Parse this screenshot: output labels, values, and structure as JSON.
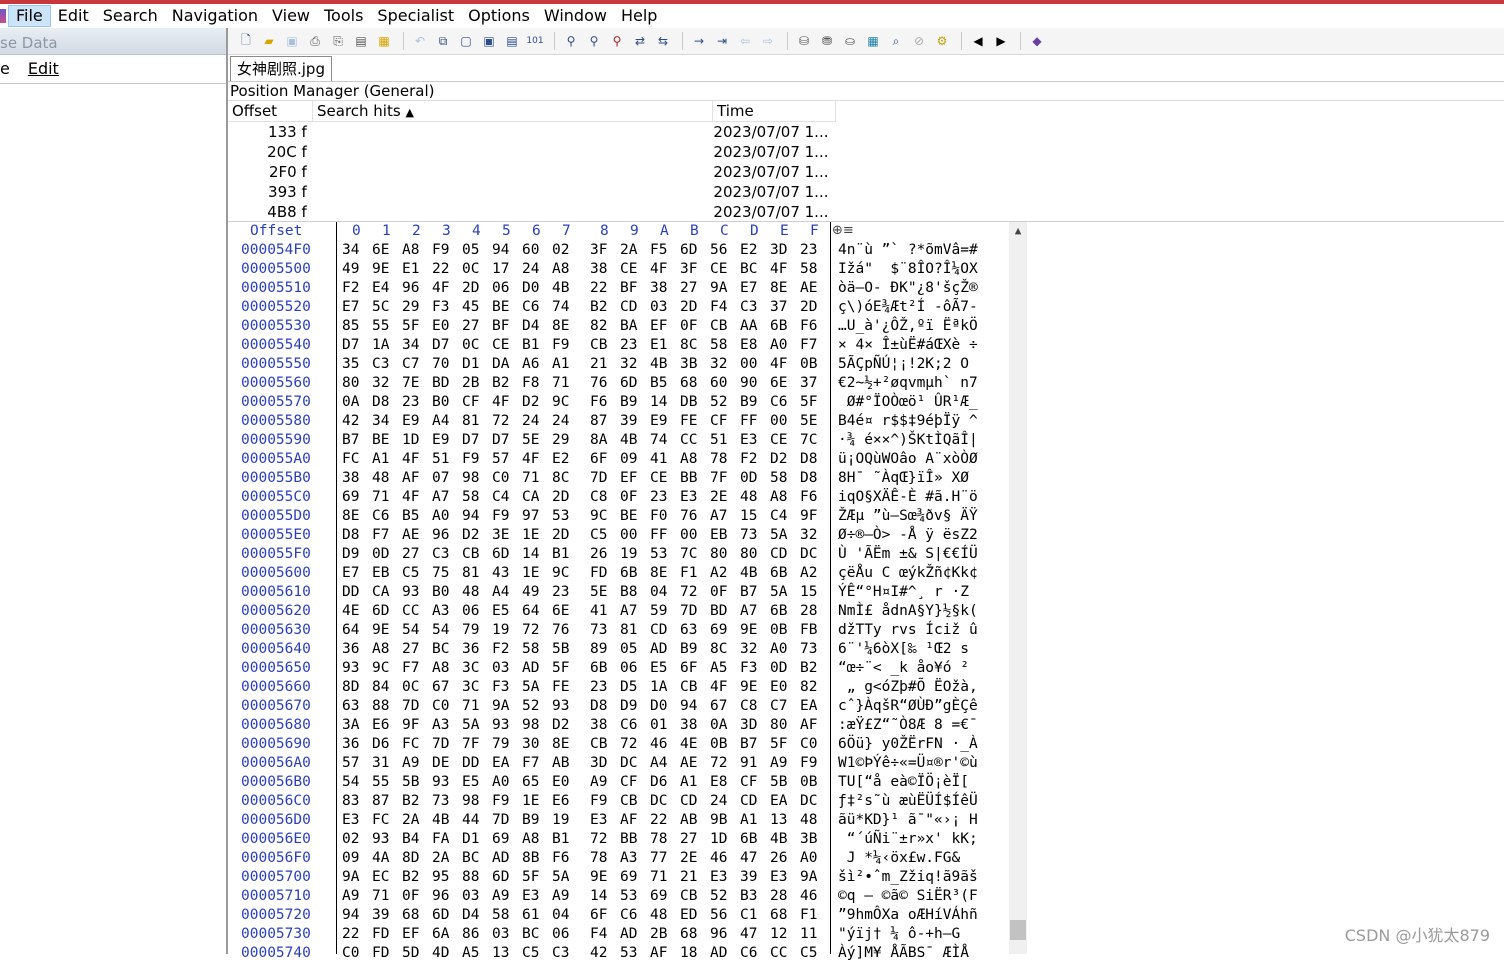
{
  "menubar": {
    "items": [
      "File",
      "Edit",
      "Search",
      "Navigation",
      "View",
      "Tools",
      "Specialist",
      "Options",
      "Window",
      "Help"
    ]
  },
  "left_panel": {
    "title": "se Data",
    "menu": [
      "e",
      "Edit"
    ]
  },
  "toolbar": {
    "icons": [
      "new-file-icon",
      "open-file-icon",
      "save-icon",
      "print-icon",
      "print-preview-icon",
      "properties-icon",
      "folder-icon",
      "undo-icon",
      "copy-icon",
      "paste-icon",
      "paste-special-icon",
      "clipboard-icon",
      "binary-icon",
      "find-icon",
      "find-next-icon",
      "find-hex-icon",
      "replace-icon",
      "replace-hex-icon",
      "goto-icon",
      "goto-offset-icon",
      "back-icon",
      "forward-icon",
      "disk-icon",
      "disk-stack-icon",
      "drive-icon",
      "calculator-icon",
      "magnify-icon",
      "no-icon",
      "gear-icon",
      "prev-icon",
      "next-icon",
      "book-icon"
    ]
  },
  "tab": {
    "label": "女神剧照.jpg"
  },
  "position_manager": {
    "title": "Position Manager (General)",
    "columns": {
      "offset": "Offset",
      "hits": "Search hits",
      "time": "Time"
    },
    "sort_arrow": "▲",
    "rows": [
      {
        "offset": "133 f",
        "hits": "",
        "time": "2023/07/07  1..."
      },
      {
        "offset": "20C f",
        "hits": "",
        "time": "2023/07/07  1..."
      },
      {
        "offset": "2F0 f",
        "hits": "",
        "time": "2023/07/07  1..."
      },
      {
        "offset": "393 f",
        "hits": "",
        "time": "2023/07/07  1..."
      },
      {
        "offset": "4B8 f",
        "hits": "",
        "time": "2023/07/07  1..."
      }
    ]
  },
  "hex": {
    "offset_label": "Offset",
    "columns": [
      "0",
      "1",
      "2",
      "3",
      "4",
      "5",
      "6",
      "7",
      "8",
      "9",
      "A",
      "B",
      "C",
      "D",
      "E",
      "F"
    ],
    "rows": [
      {
        "off": "000054F0",
        "bytes": [
          "34",
          "6E",
          "A8",
          "F9",
          "05",
          "94",
          "60",
          "02",
          "3F",
          "2A",
          "F5",
          "6D",
          "56",
          "E2",
          "3D",
          "23"
        ],
        "text": "4n¨ù ”` ?*õmVâ=#"
      },
      {
        "off": "00005500",
        "bytes": [
          "49",
          "9E",
          "E1",
          "22",
          "0C",
          "17",
          "24",
          "A8",
          "38",
          "CE",
          "4F",
          "3F",
          "CE",
          "BC",
          "4F",
          "58"
        ],
        "text": "Ižá\"  $¨8ÎO?Î¼OX"
      },
      {
        "off": "00005510",
        "bytes": [
          "F2",
          "E4",
          "96",
          "4F",
          "2D",
          "06",
          "D0",
          "4B",
          "22",
          "BF",
          "38",
          "27",
          "9A",
          "E7",
          "8E",
          "AE"
        ],
        "text": "òä–O- ÐK\"¿8'šçŽ®"
      },
      {
        "off": "00005520",
        "bytes": [
          "E7",
          "5C",
          "29",
          "F3",
          "45",
          "BE",
          "C6",
          "74",
          "B2",
          "CD",
          "03",
          "2D",
          "F4",
          "C3",
          "37",
          "2D"
        ],
        "text": "ç\\)óE¾Æt²Í -ôÃ7-"
      },
      {
        "off": "00005530",
        "bytes": [
          "85",
          "55",
          "5F",
          "E0",
          "27",
          "BF",
          "D4",
          "8E",
          "82",
          "BA",
          "EF",
          "0F",
          "CB",
          "AA",
          "6B",
          "F6"
        ],
        "text": "…U_à'¿ÔŽ‚ºï ËªkÖ"
      },
      {
        "off": "00005540",
        "bytes": [
          "D7",
          "1A",
          "34",
          "D7",
          "0C",
          "CE",
          "B1",
          "F9",
          "CB",
          "23",
          "E1",
          "8C",
          "58",
          "E8",
          "A0",
          "F7"
        ],
        "text": "× 4× Î±ùË#áŒXè ÷"
      },
      {
        "off": "00005550",
        "bytes": [
          "35",
          "C3",
          "C7",
          "70",
          "D1",
          "DA",
          "A6",
          "A1",
          "21",
          "32",
          "4B",
          "3B",
          "32",
          "00",
          "4F",
          "0B"
        ],
        "text": "5ÃÇpÑÚ¦¡!2K;2 O"
      },
      {
        "off": "00005560",
        "bytes": [
          "80",
          "32",
          "7E",
          "BD",
          "2B",
          "B2",
          "F8",
          "71",
          "76",
          "6D",
          "B5",
          "68",
          "60",
          "90",
          "6E",
          "37"
        ],
        "text": "€2~½+²øqvmµh` n7"
      },
      {
        "off": "00005570",
        "bytes": [
          "0A",
          "D8",
          "23",
          "B0",
          "CF",
          "4F",
          "D2",
          "9C",
          "F6",
          "B9",
          "14",
          "DB",
          "52",
          "B9",
          "C6",
          "5F"
        ],
        "text": " Ø#°ÏOÒœö¹ ÛR¹Æ_"
      },
      {
        "off": "00005580",
        "bytes": [
          "42",
          "34",
          "E9",
          "A4",
          "81",
          "72",
          "24",
          "24",
          "87",
          "39",
          "E9",
          "FE",
          "CF",
          "FF",
          "00",
          "5E"
        ],
        "text": "B4é¤ r$$‡9éþÏÿ ^"
      },
      {
        "off": "00005590",
        "bytes": [
          "B7",
          "BE",
          "1D",
          "E9",
          "D7",
          "D7",
          "5E",
          "29",
          "8A",
          "4B",
          "74",
          "CC",
          "51",
          "E3",
          "CE",
          "7C"
        ],
        "text": "·¾ é××^)ŠKtÌQãÎ|"
      },
      {
        "off": "000055A0",
        "bytes": [
          "FC",
          "A1",
          "4F",
          "51",
          "F9",
          "57",
          "4F",
          "E2",
          "6F",
          "09",
          "41",
          "A8",
          "78",
          "F2",
          "D2",
          "D8"
        ],
        "text": "ü¡OQùWOâo A¨xòÒØ"
      },
      {
        "off": "000055B0",
        "bytes": [
          "38",
          "48",
          "AF",
          "07",
          "98",
          "C0",
          "71",
          "8C",
          "7D",
          "EF",
          "CE",
          "BB",
          "7F",
          "0D",
          "58",
          "D8"
        ],
        "text": "8H¯ ˜ÀqŒ}ïÎ» XØ"
      },
      {
        "off": "000055C0",
        "bytes": [
          "69",
          "71",
          "4F",
          "A7",
          "58",
          "C4",
          "CA",
          "2D",
          "C8",
          "0F",
          "23",
          "E3",
          "2E",
          "48",
          "A8",
          "F6"
        ],
        "text": "iqO§XÄÊ-È #ã.H¨ö"
      },
      {
        "off": "000055D0",
        "bytes": [
          "8E",
          "C6",
          "B5",
          "A0",
          "94",
          "F9",
          "97",
          "53",
          "9C",
          "BE",
          "F0",
          "76",
          "A7",
          "15",
          "C4",
          "9F"
        ],
        "text": "ŽÆµ ”ù—Sœ¾ðv§ ÄŸ"
      },
      {
        "off": "000055E0",
        "bytes": [
          "D8",
          "F7",
          "AE",
          "96",
          "D2",
          "3E",
          "1E",
          "2D",
          "C5",
          "00",
          "FF",
          "00",
          "EB",
          "73",
          "5A",
          "32"
        ],
        "text": "Ø÷®–Ò> -Å ÿ ësZ2"
      },
      {
        "off": "000055F0",
        "bytes": [
          "D9",
          "0D",
          "27",
          "C3",
          "CB",
          "6D",
          "14",
          "B1",
          "26",
          "19",
          "53",
          "7C",
          "80",
          "80",
          "CD",
          "DC"
        ],
        "text": "Ù 'ÃËm ±& S|€€ÍÜ"
      },
      {
        "off": "00005600",
        "bytes": [
          "E7",
          "EB",
          "C5",
          "75",
          "81",
          "43",
          "1E",
          "9C",
          "FD",
          "6B",
          "8E",
          "F1",
          "A2",
          "4B",
          "6B",
          "A2"
        ],
        "text": "çëÅu C œýkŽñ¢Kk¢"
      },
      {
        "off": "00005610",
        "bytes": [
          "DD",
          "CA",
          "93",
          "B0",
          "48",
          "A4",
          "49",
          "23",
          "5E",
          "B8",
          "04",
          "72",
          "0F",
          "B7",
          "5A",
          "15"
        ],
        "text": "ÝÊ“°H¤I#^¸ r ·Z "
      },
      {
        "off": "00005620",
        "bytes": [
          "4E",
          "6D",
          "CC",
          "A3",
          "06",
          "E5",
          "64",
          "6E",
          "41",
          "A7",
          "59",
          "7D",
          "BD",
          "A7",
          "6B",
          "28"
        ],
        "text": "NmÌ£ ådnA§Y}½§k("
      },
      {
        "off": "00005630",
        "bytes": [
          "64",
          "9E",
          "54",
          "54",
          "79",
          "19",
          "72",
          "76",
          "73",
          "81",
          "CD",
          "63",
          "69",
          "9E",
          "0B",
          "FB"
        ],
        "text": "džTTy rvs Íciž û"
      },
      {
        "off": "00005640",
        "bytes": [
          "36",
          "A8",
          "27",
          "BC",
          "36",
          "F2",
          "58",
          "5B",
          "89",
          "05",
          "AD",
          "B9",
          "8C",
          "32",
          "A0",
          "73"
        ],
        "text": "6¨'¼6òX[‰ ­¹Œ2 s"
      },
      {
        "off": "00005650",
        "bytes": [
          "93",
          "9C",
          "F7",
          "A8",
          "3C",
          "03",
          "AD",
          "5F",
          "6B",
          "06",
          "E5",
          "6F",
          "A5",
          "F3",
          "0D",
          "B2"
        ],
        "text": "“œ÷¨< ­_k åo¥ó ²"
      },
      {
        "off": "00005660",
        "bytes": [
          "8D",
          "84",
          "0C",
          "67",
          "3C",
          "F3",
          "5A",
          "FE",
          "23",
          "D5",
          "1A",
          "CB",
          "4F",
          "9E",
          "E0",
          "82"
        ],
        "text": " „ g<óZþ#Õ ËOžà,"
      },
      {
        "off": "00005670",
        "bytes": [
          "63",
          "88",
          "7D",
          "C0",
          "71",
          "9A",
          "52",
          "93",
          "D8",
          "D9",
          "D0",
          "94",
          "67",
          "C8",
          "C7",
          "EA"
        ],
        "text": "cˆ}ÀqšR“ØÙÐ”gÈÇê"
      },
      {
        "off": "00005680",
        "bytes": [
          "3A",
          "E6",
          "9F",
          "A3",
          "5A",
          "93",
          "98",
          "D2",
          "38",
          "C6",
          "01",
          "38",
          "0A",
          "3D",
          "80",
          "AF"
        ],
        "text": ":æŸ£Z“˜Ò8Æ 8 =€¯"
      },
      {
        "off": "00005690",
        "bytes": [
          "36",
          "D6",
          "FC",
          "7D",
          "7F",
          "79",
          "30",
          "8E",
          "CB",
          "72",
          "46",
          "4E",
          "0B",
          "B7",
          "5F",
          "C0"
        ],
        "text": "6Öü} y0ŽËrFN ·_À"
      },
      {
        "off": "000056A0",
        "bytes": [
          "57",
          "31",
          "A9",
          "DE",
          "DD",
          "EA",
          "F7",
          "AB",
          "3D",
          "DC",
          "A4",
          "AE",
          "72",
          "91",
          "A9",
          "F9"
        ],
        "text": "W1©ÞÝê÷«=Ü¤®r'©ù"
      },
      {
        "off": "000056B0",
        "bytes": [
          "54",
          "55",
          "5B",
          "93",
          "E5",
          "A0",
          "65",
          "E0",
          "A9",
          "CF",
          "D6",
          "A1",
          "E8",
          "CF",
          "5B",
          "0B"
        ],
        "text": "TU[“å eà©ÏÖ¡èÏ[ "
      },
      {
        "off": "000056C0",
        "bytes": [
          "83",
          "87",
          "B2",
          "73",
          "98",
          "F9",
          "1E",
          "E6",
          "F9",
          "CB",
          "DC",
          "CD",
          "24",
          "CD",
          "EA",
          "DC"
        ],
        "text": "ƒ‡²s˜ù æùËÜÍ$ÍêÜ"
      },
      {
        "off": "000056D0",
        "bytes": [
          "E3",
          "FC",
          "2A",
          "4B",
          "44",
          "7D",
          "B9",
          "19",
          "E3",
          "AF",
          "22",
          "AB",
          "9B",
          "A1",
          "13",
          "48"
        ],
        "text": "ãü*KD}¹ ã¯\"«›¡ H"
      },
      {
        "off": "000056E0",
        "bytes": [
          "02",
          "93",
          "B4",
          "FA",
          "D1",
          "69",
          "A8",
          "B1",
          "72",
          "BB",
          "78",
          "27",
          "1D",
          "6B",
          "4B",
          "3B"
        ],
        "text": " “´úÑi¨±r»x' kK;"
      },
      {
        "off": "000056F0",
        "bytes": [
          "09",
          "4A",
          "8D",
          "2A",
          "BC",
          "AD",
          "8B",
          "F6",
          "78",
          "A3",
          "77",
          "2E",
          "46",
          "47",
          "26",
          "A0"
        ],
        "text": " J *¼­‹öx£w.FG& "
      },
      {
        "off": "00005700",
        "bytes": [
          "9A",
          "EC",
          "B2",
          "95",
          "88",
          "6D",
          "5F",
          "5A",
          "9E",
          "69",
          "71",
          "21",
          "E3",
          "39",
          "E3",
          "9A"
        ],
        "text": "šì²•ˆm_Zžiq!ã9ãš"
      },
      {
        "off": "00005710",
        "bytes": [
          "A9",
          "71",
          "0F",
          "96",
          "03",
          "A9",
          "E3",
          "A9",
          "14",
          "53",
          "69",
          "CB",
          "52",
          "B3",
          "28",
          "46"
        ],
        "text": "©q – ©ã© SiËR³(F"
      },
      {
        "off": "00005720",
        "bytes": [
          "94",
          "39",
          "68",
          "6D",
          "D4",
          "58",
          "61",
          "04",
          "6F",
          "C6",
          "48",
          "ED",
          "56",
          "C1",
          "68",
          "F1"
        ],
        "text": "”9hmÔXa oÆHíVÁhñ"
      },
      {
        "off": "00005730",
        "bytes": [
          "22",
          "FD",
          "EF",
          "6A",
          "86",
          "03",
          "BC",
          "06",
          "F4",
          "AD",
          "2B",
          "68",
          "96",
          "47",
          "12",
          "11"
        ],
        "text": "\"ýïj† ¼ ô-+h–G  "
      },
      {
        "off": "00005740",
        "bytes": [
          "C0",
          "FD",
          "5D",
          "4D",
          "A5",
          "13",
          "C5",
          "C3",
          "42",
          "53",
          "AF",
          "18",
          "AD",
          "C6",
          "CC",
          "C5"
        ],
        "text": "Àý]M¥ ÅÃBS¯ ­ÆÌÅ"
      }
    ]
  },
  "watermark": "CSDN @小犹太879"
}
